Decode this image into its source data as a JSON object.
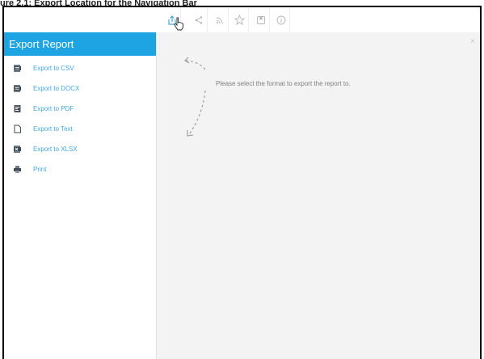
{
  "caption": "ure 2.1: Export Location for the Navigation Bar",
  "toolbar": {
    "buttons": [
      {
        "name": "export",
        "icon": "export-icon"
      },
      {
        "name": "share",
        "icon": "share-icon"
      },
      {
        "name": "rss",
        "icon": "rss-icon"
      },
      {
        "name": "favourite",
        "icon": "star-icon"
      },
      {
        "name": "bookmark",
        "icon": "bookmark-icon"
      },
      {
        "name": "info",
        "icon": "info-icon"
      }
    ]
  },
  "sidebar": {
    "title": "Export Report",
    "items": [
      {
        "label": "Export to CSV",
        "icon": "csv-file-icon"
      },
      {
        "label": "Export to DOCX",
        "icon": "docx-file-icon"
      },
      {
        "label": "Export to PDF",
        "icon": "pdf-file-icon"
      },
      {
        "label": "Export to Text",
        "icon": "text-file-icon"
      },
      {
        "label": "Export to XLSX",
        "icon": "xlsx-file-icon"
      },
      {
        "label": "Print",
        "icon": "printer-icon"
      }
    ]
  },
  "content": {
    "close_label": "×",
    "message": "Please select the format to export the report to."
  },
  "colors": {
    "header": "#1ea4e3",
    "link": "#44a8e0",
    "panel_bg": "#f3f3f3"
  }
}
